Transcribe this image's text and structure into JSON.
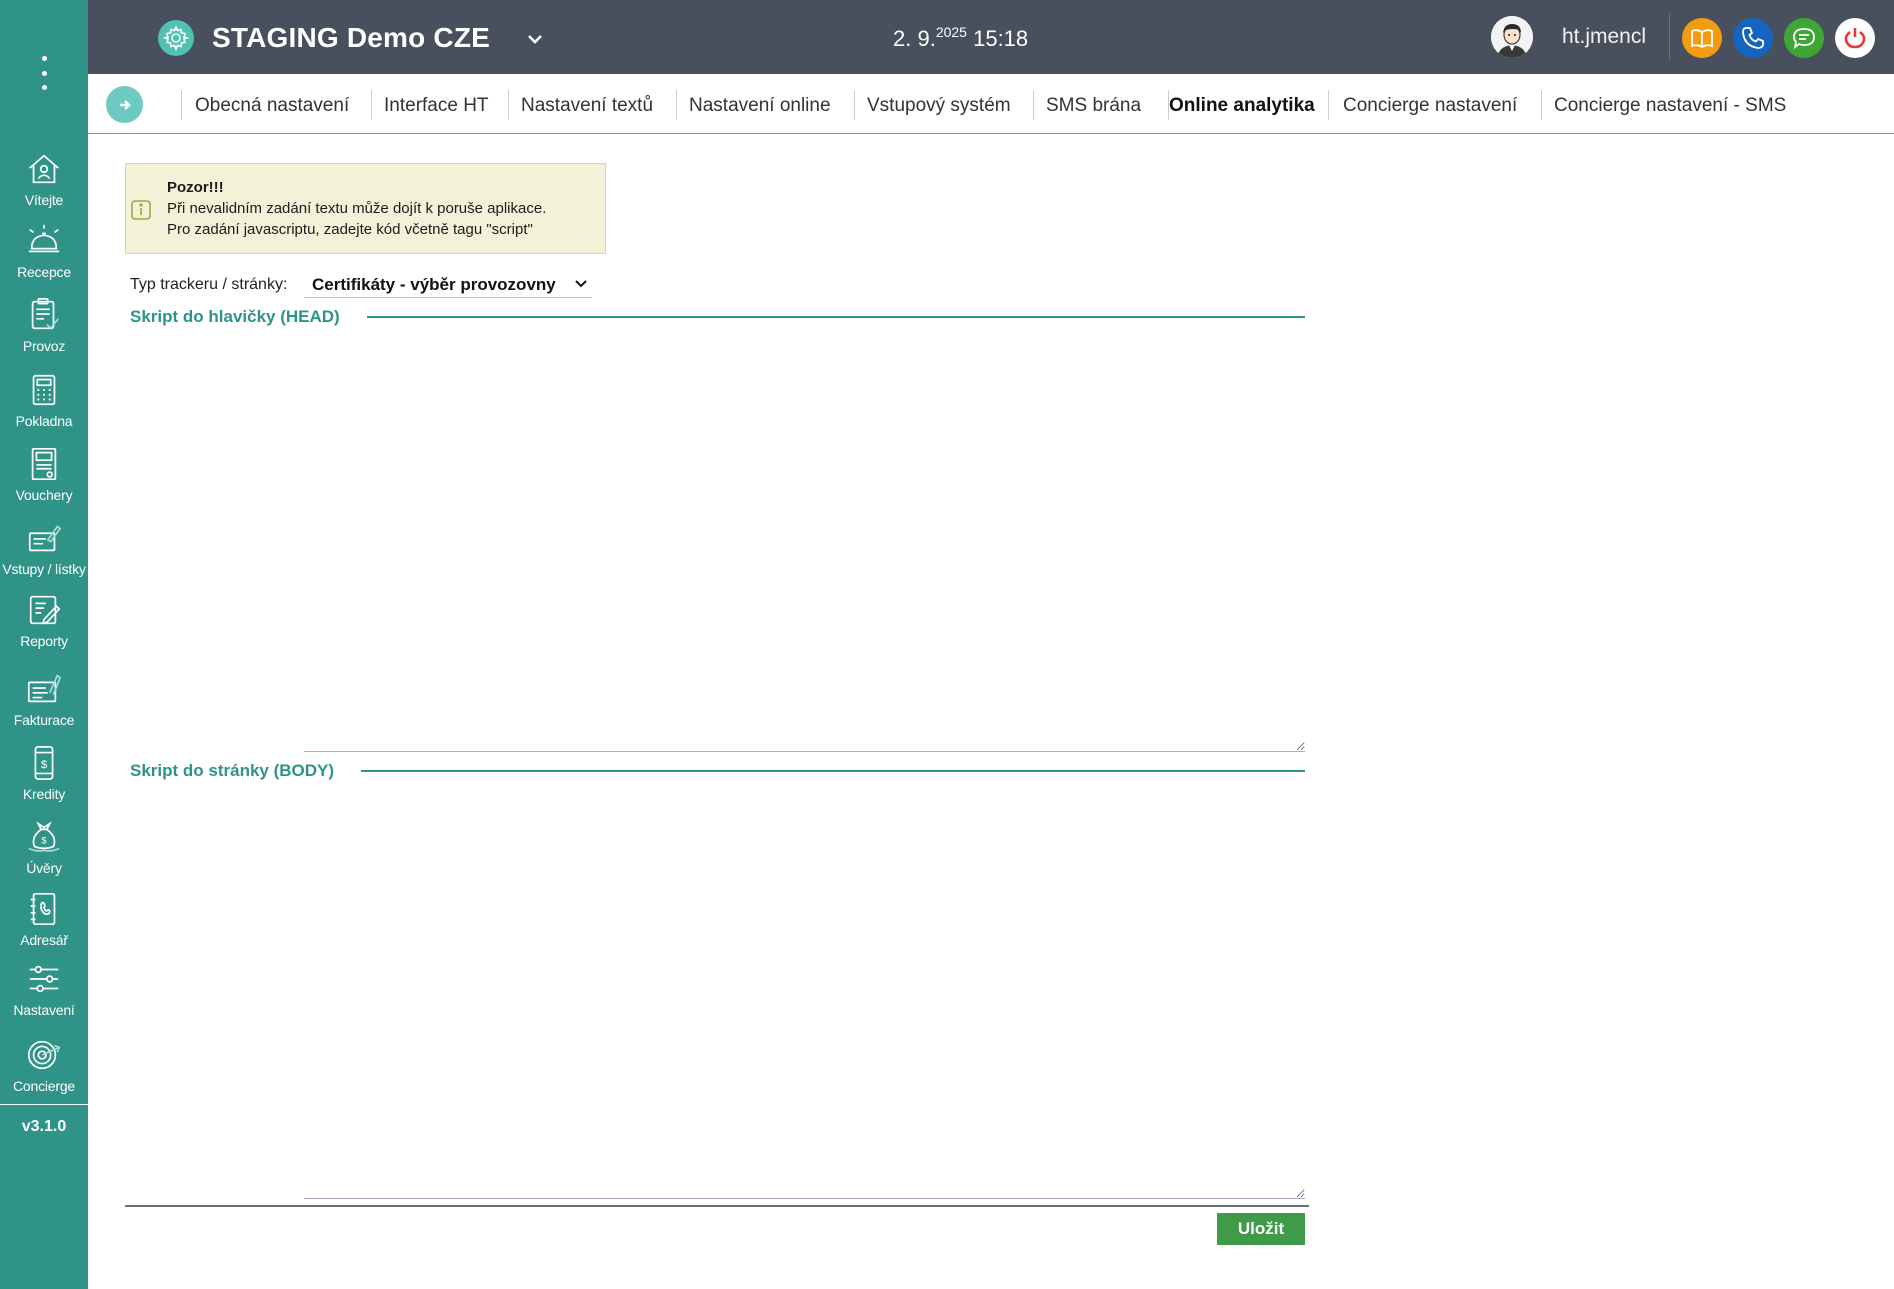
{
  "header": {
    "app_title": "STAGING Demo CZE",
    "date": "2. 9.",
    "year": "2025",
    "time": "15:18",
    "username": "ht.jmencl",
    "buttons": {
      "book_color": "#f39c12",
      "phone_color": "#1565c0",
      "chat_color": "#3fa535",
      "power_color": "#e53935"
    }
  },
  "sidebar": {
    "items": [
      {
        "label": "Vítejte",
        "icon": "home-icon"
      },
      {
        "label": "Recepce",
        "icon": "reception-bell-icon"
      },
      {
        "label": "Provoz",
        "icon": "clipboard-check-icon"
      },
      {
        "label": "Pokladna",
        "icon": "cash-register-icon"
      },
      {
        "label": "Vouchery",
        "icon": "voucher-icon"
      },
      {
        "label": "Vstupy / lístky",
        "icon": "ticket-pen-icon"
      },
      {
        "label": "Reporty",
        "icon": "report-icon"
      },
      {
        "label": "Fakturace",
        "icon": "invoice-icon"
      },
      {
        "label": "Kredity",
        "icon": "phone-credit-icon"
      },
      {
        "label": "Úvěry",
        "icon": "money-bag-icon"
      },
      {
        "label": "Adresář",
        "icon": "address-book-icon"
      },
      {
        "label": "Nastavení",
        "icon": "sliders-icon"
      },
      {
        "label": "Concierge",
        "icon": "target-icon"
      }
    ],
    "version": "v3.1.0"
  },
  "tabs": [
    {
      "label": "Obecná nastavení",
      "active": false
    },
    {
      "label": "Interface HT",
      "active": false
    },
    {
      "label": "Nastavení textů",
      "active": false
    },
    {
      "label": "Nastavení online",
      "active": false
    },
    {
      "label": "Vstupový systém",
      "active": false
    },
    {
      "label": "SMS brána",
      "active": false
    },
    {
      "label": "Online analytika",
      "active": true
    },
    {
      "label": "Concierge nastavení",
      "active": false
    },
    {
      "label": "Concierge nastavení - SMS",
      "active": false
    }
  ],
  "warning": {
    "title": "Pozor!!!",
    "line1": "Při nevalidním zadání textu může dojít k poruše aplikace.",
    "line2": "Pro zadání javascriptu, zadejte kód včetně tagu \"script\""
  },
  "tracker": {
    "label": "Typ trackeru / stránky:",
    "selected": "Certifikáty - výběr provozovny"
  },
  "sections": {
    "head_title": "Skript do hlavičky (HEAD)",
    "head_value": "",
    "body_title": "Skript do stránky (BODY)",
    "body_value": ""
  },
  "actions": {
    "save_label": "Uložit"
  },
  "colors": {
    "sidebar": "#2f9387",
    "header": "#48505e",
    "accent": "#2f9387",
    "save": "#3f9b47"
  }
}
